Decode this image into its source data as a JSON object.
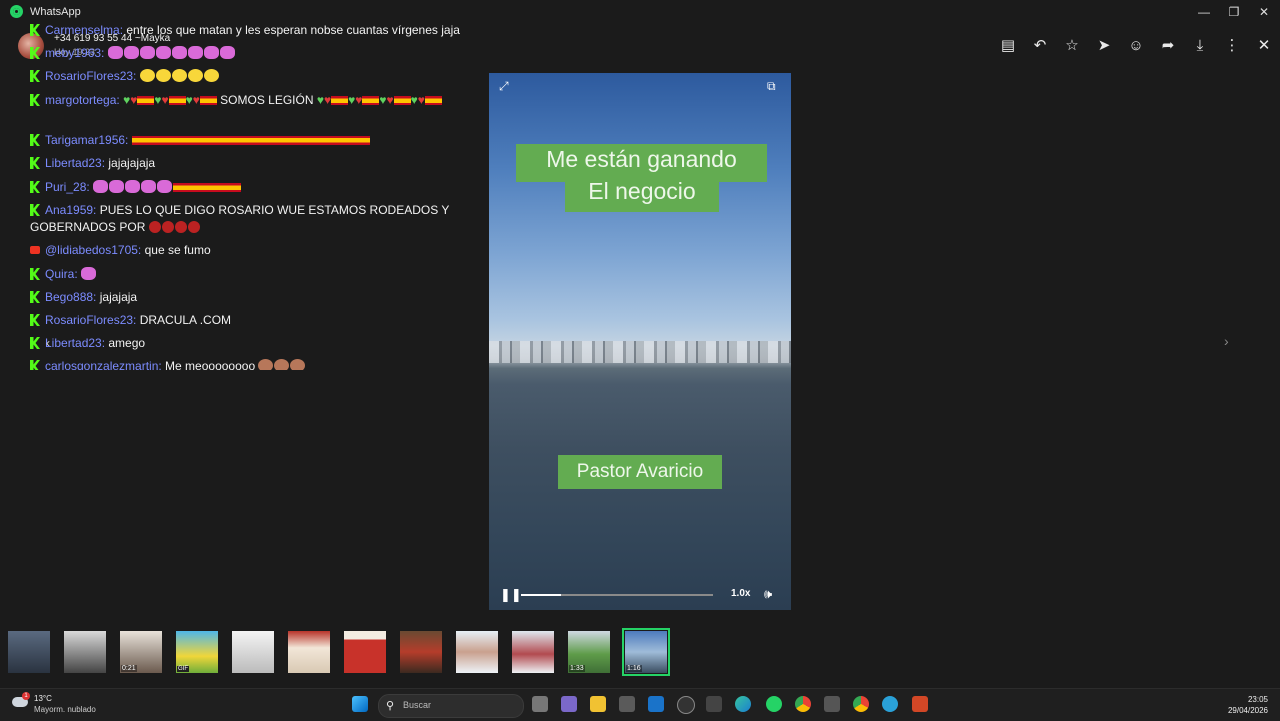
{
  "window": {
    "title": "WhatsApp"
  },
  "viewer": {
    "sender": "+34 619 93 55 44 ~Mayka",
    "time": "Hoy 19:23"
  },
  "chat": {
    "messages": [
      {
        "platform": "kick",
        "user": "Carmenselma:",
        "text": " entre los que matan y les esperan nobse cuantas vírgenes jaja"
      },
      {
        "platform": "kick",
        "user": "meby1963:",
        "text": ""
      },
      {
        "platform": "kick",
        "user": "RosarioFlores23:",
        "text": ""
      },
      {
        "platform": "kick",
        "user": "margotortega:",
        "text": " SOMOS LEGIÓN"
      },
      {
        "platform": "kick",
        "user": "Tarigamar1956:",
        "text": ""
      },
      {
        "platform": "kick",
        "user": "Libertad23:",
        "text": " jajajajaja"
      },
      {
        "platform": "kick",
        "user": "Puri_28:",
        "text": ""
      },
      {
        "platform": "kick",
        "user": "Ana1959:",
        "text": " PUES LO QUE DIGO ROSARIO WUE ESTAMOS RODEADOS Y GOBERNADOS POR"
      },
      {
        "platform": "youtube",
        "user": "@lidiabedos1705:",
        "text": " que se fumo"
      },
      {
        "platform": "kick",
        "user": "Quira:",
        "text": ""
      },
      {
        "platform": "kick",
        "user": "Bego888:",
        "text": " jajajaja"
      },
      {
        "platform": "kick",
        "user": "RosarioFlores23:",
        "text": " DRACULA .COM"
      },
      {
        "platform": "kick",
        "user": "Libertad23:",
        "text": " amego"
      },
      {
        "platform": "kick",
        "user": "carlosgonzalezmartin:",
        "text": " Me meoooooooo"
      }
    ]
  },
  "video": {
    "caption_line1": "Me están  ganando",
    "caption_line2": "El negocio",
    "caption_bottom": "Pastor Avaricio",
    "speed": "1.0x",
    "progress": 0.21
  },
  "thumbnails": [
    {
      "dur": ""
    },
    {
      "dur": ""
    },
    {
      "dur": "0:21"
    },
    {
      "dur": "GIF"
    },
    {
      "dur": ""
    },
    {
      "dur": ""
    },
    {
      "dur": ""
    },
    {
      "dur": ""
    },
    {
      "dur": ""
    },
    {
      "dur": ""
    },
    {
      "dur": "1:33"
    },
    {
      "dur": "1:16"
    }
  ],
  "taskbar": {
    "weather_temp": "13°C",
    "weather_desc": "Mayorm. nublado",
    "weather_badge": "1",
    "search_placeholder": "Buscar",
    "time": "23:05",
    "date": "29/04/2026"
  },
  "colors": {
    "accent": "#25d366",
    "username": "#7c8cff",
    "caption_bg": "#63ac51",
    "kick": "#53fc18"
  }
}
